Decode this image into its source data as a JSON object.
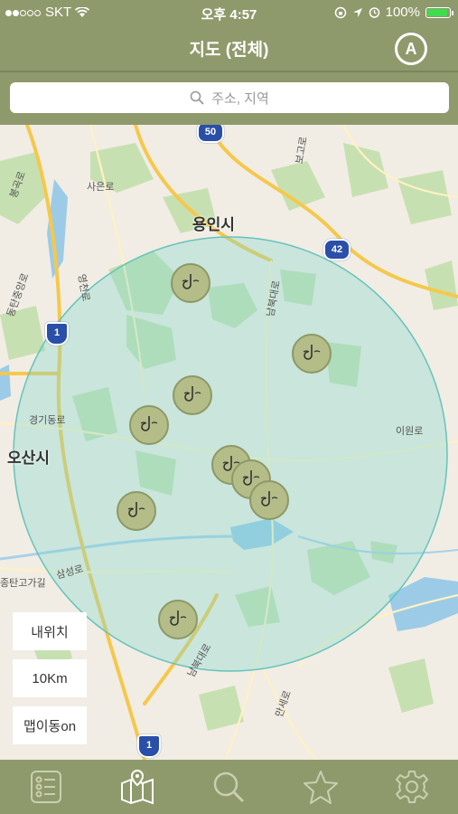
{
  "status": {
    "carrier": "SKT",
    "time": "오후 4:57",
    "battery": "100%"
  },
  "nav": {
    "title": "지도 (전체)",
    "a_button": "A"
  },
  "search": {
    "placeholder": "주소, 지역"
  },
  "map": {
    "labels": {
      "yongin": "용인시",
      "osan": "오산시",
      "gyeonggi_ro": "경기동로",
      "namsa_ro": "남북대로",
      "iwon_ro": "이원로",
      "sareun_ro": "사은로",
      "bonggok": "봉곡로",
      "yeongcheon": "영천로",
      "bogwang": "보고로",
      "dongtan": "동탄중앙로",
      "samsung": "삼성로",
      "jungtan": "종탄고가길",
      "namseo": "남북대로",
      "manse": "만세로"
    },
    "shields": {
      "r50": "50",
      "r42": "42",
      "r1_top": "1",
      "r1_bottom": "1"
    },
    "buttons": {
      "my_location": "내위치",
      "radius": "10Km",
      "map_move": "맵이동on"
    }
  },
  "tabs": [
    "list-icon",
    "map-icon",
    "search-icon",
    "star-icon",
    "gear-icon"
  ],
  "colors": {
    "bar": "#8e9a6b",
    "circle": "#7fd6cd",
    "marker": "#b4bd88"
  }
}
